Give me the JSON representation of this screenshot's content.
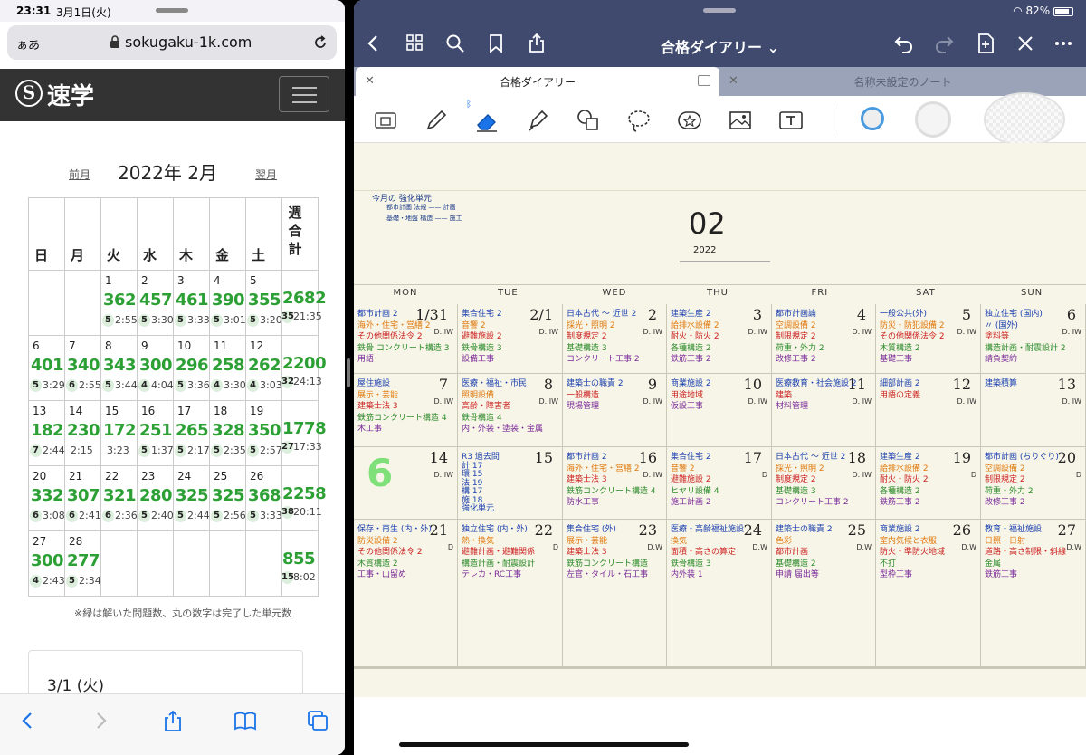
{
  "left_status": {
    "time": "23:31",
    "date": "3月1日(火)"
  },
  "browser": {
    "aa": "ぁあ",
    "url": "sokugaku-1k.com"
  },
  "site": {
    "logo_mark": "S",
    "logo_text": "速学"
  },
  "calendar": {
    "title": "2022年 2月",
    "prev": "前月",
    "next": "翌月",
    "headers": [
      "日",
      "月",
      "火",
      "水",
      "木",
      "金",
      "土"
    ],
    "total_header": [
      "週",
      "合",
      "計"
    ],
    "weeks": [
      {
        "days": [
          null,
          null,
          {
            "d": "1",
            "c": "362",
            "u": "5",
            "t": "2:55"
          },
          {
            "d": "2",
            "c": "457",
            "u": "5",
            "t": "3:30"
          },
          {
            "d": "3",
            "c": "461",
            "u": "5",
            "t": "3:33"
          },
          {
            "d": "4",
            "c": "390",
            "u": "5",
            "t": "3:01"
          },
          {
            "d": "5",
            "c": "355",
            "u": "5",
            "t": "3:20"
          }
        ],
        "total": {
          "c": "2682",
          "u": "35",
          "t": "21:35"
        }
      },
      {
        "days": [
          {
            "d": "6",
            "c": "401",
            "u": "5",
            "t": "3:29"
          },
          {
            "d": "7",
            "c": "340",
            "u": "6",
            "t": "2:55"
          },
          {
            "d": "8",
            "c": "343",
            "u": "5",
            "t": "3:44"
          },
          {
            "d": "9",
            "c": "300",
            "u": "4",
            "t": "4:04"
          },
          {
            "d": "10",
            "c": "296",
            "u": "5",
            "t": "3:36"
          },
          {
            "d": "11",
            "c": "258",
            "u": "4",
            "t": "3:30"
          },
          {
            "d": "12",
            "c": "262",
            "u": "4",
            "t": "3:03"
          }
        ],
        "total": {
          "c": "2200",
          "u": "32",
          "t": "24:13"
        }
      },
      {
        "days": [
          {
            "d": "13",
            "c": "182",
            "u": "7",
            "t": "2:44"
          },
          {
            "d": "14",
            "c": "230",
            "u": "",
            "t": "2:15"
          },
          {
            "d": "15",
            "c": "172",
            "u": "",
            "t": "3:23"
          },
          {
            "d": "16",
            "c": "251",
            "u": "5",
            "t": "1:37"
          },
          {
            "d": "17",
            "c": "265",
            "u": "5",
            "t": "2:17"
          },
          {
            "d": "18",
            "c": "328",
            "u": "5",
            "t": "2:35"
          },
          {
            "d": "19",
            "c": "350",
            "u": "5",
            "t": "2:57"
          }
        ],
        "total": {
          "c": "1778",
          "u": "27",
          "t": "17:33"
        }
      },
      {
        "days": [
          {
            "d": "20",
            "c": "332",
            "u": "6",
            "t": "3:08"
          },
          {
            "d": "21",
            "c": "307",
            "u": "6",
            "t": "2:41"
          },
          {
            "d": "22",
            "c": "321",
            "u": "6",
            "t": "2:36"
          },
          {
            "d": "23",
            "c": "280",
            "u": "5",
            "t": "2:40"
          },
          {
            "d": "24",
            "c": "325",
            "u": "5",
            "t": "2:44"
          },
          {
            "d": "25",
            "c": "325",
            "u": "5",
            "t": "2:56"
          },
          {
            "d": "26",
            "c": "368",
            "u": "5",
            "t": "3:33"
          }
        ],
        "total": {
          "c": "2258",
          "u": "38",
          "t": "20:11"
        }
      },
      {
        "days": [
          {
            "d": "27",
            "c": "300",
            "u": "4",
            "t": "2:43"
          },
          {
            "d": "28",
            "c": "277",
            "u": "5",
            "t": "2:34"
          },
          null,
          null,
          null,
          null,
          null
        ],
        "total": {
          "c": "855",
          "u": "15",
          "t": "8:02"
        }
      }
    ],
    "note": "※緑は解いた問題数、丸の数字は完了した単元数",
    "detail_date": "3/1 (火)"
  },
  "right_status": {
    "battery": "82%"
  },
  "goodnotes": {
    "title": "合格ダイアリー ⌄",
    "tab_active": "合格ダイアリー",
    "tab_inactive": "名称未設定のノート",
    "page": {
      "header_note": [
        "今月の 強化単元",
        "都市計画  法規 —— 計画",
        "基礎・地盤  構造 —— 施工"
      ],
      "month": "02",
      "year": "2022",
      "dow": [
        "MON",
        "TUE",
        "WED",
        "THU",
        "FRI",
        "SAT",
        "SUN"
      ],
      "big_digit": "6",
      "weeks": [
        [
          {
            "dn": "1/31",
            "lines": [
              [
                "都市計画 2",
                "#1a3fb0"
              ],
              [
                "海外・住宅・営繕 2",
                "#e07a10"
              ],
              [
                "その他関係法令 2",
                "#cc2222"
              ],
              [
                "鉄骨 コンクリート構造 3",
                "#2a8a2a"
              ],
              [
                "用語",
                "#7a2a9a"
              ]
            ],
            "dw": "D. IW"
          },
          {
            "dn": "2/1",
            "lines": [
              [
                "集合住宅 2",
                "#1a3fb0"
              ],
              [
                "音響 2",
                "#e07a10"
              ],
              [
                "避難施設 2",
                "#cc2222"
              ],
              [
                "鉄骨構造 3",
                "#2a8a2a"
              ],
              [
                "設備工事",
                "#7a2a9a"
              ]
            ],
            "dw": "D. IW"
          },
          {
            "dn": "2",
            "lines": [
              [
                "日本古代 〜 近世 2",
                "#1a3fb0"
              ],
              [
                "採光・照明 2",
                "#e07a10"
              ],
              [
                "制度規定 2",
                "#cc2222"
              ],
              [
                "基礎構造 3",
                "#2a8a2a"
              ],
              [
                "コンクリート工事 2",
                "#7a2a9a"
              ]
            ],
            "dw": "D. IW"
          },
          {
            "dn": "3",
            "lines": [
              [
                "建築生産 2",
                "#1a3fb0"
              ],
              [
                "給排水設備 2",
                "#e07a10"
              ],
              [
                "耐火・防火 2",
                "#cc2222"
              ],
              [
                "各種構造 2",
                "#2a8a2a"
              ],
              [
                "鉄筋工事 2",
                "#7a2a9a"
              ]
            ],
            "dw": "D. IW"
          },
          {
            "dn": "4",
            "lines": [
              [
                "都市計画論",
                "#1a3fb0"
              ],
              [
                "空調設備 2",
                "#e07a10"
              ],
              [
                "制限規定 2",
                "#cc2222"
              ],
              [
                "荷重・外力 2",
                "#2a8a2a"
              ],
              [
                "改修工事 2",
                "#7a2a9a"
              ]
            ],
            "dw": "D. IW"
          },
          {
            "dn": "5",
            "lines": [
              [
                "一般公共(外)",
                "#1a3fb0"
              ],
              [
                "防災・防犯設備 2",
                "#e07a10"
              ],
              [
                "その他関係法令 2",
                "#cc2222"
              ],
              [
                "木質構造 2",
                "#2a8a2a"
              ],
              [
                "基礎工事",
                "#7a2a9a"
              ]
            ],
            "dw": "D. IW"
          },
          {
            "dn": "6",
            "lines": [
              [
                "独立住宅 (国内)",
                "#1a3fb0"
              ],
              [
                "〃 (国外)",
                "#1a3fb0"
              ],
              [
                "塗料等",
                "#cc2222"
              ],
              [
                "構造計画・耐震設計 2",
                "#2a8a2a"
              ],
              [
                "請負契約",
                "#7a2a9a"
              ]
            ],
            "dw": "D. IW"
          }
        ],
        [
          {
            "dn": "7",
            "lines": [
              [
                "屋住施設",
                "#1a3fb0"
              ],
              [
                "展示・芸能",
                "#e07a10"
              ],
              [
                "建築士法 3",
                "#cc2222"
              ],
              [
                "鉄筋コンクリート構造 4",
                "#2a8a2a"
              ],
              [
                "木工事",
                "#7a2a9a"
              ]
            ],
            "dw": "D. IW"
          },
          {
            "dn": "8",
            "lines": [
              [
                "医療・福祉・市民",
                "#1a3fb0"
              ],
              [
                "照明設備",
                "#e07a10"
              ],
              [
                "高齢・障害者",
                "#cc2222"
              ],
              [
                "鉄骨構造 4",
                "#2a8a2a"
              ],
              [
                "内・外装・塗装・金属",
                "#7a2a9a"
              ]
            ],
            "dw": "D. IW"
          },
          {
            "dn": "9",
            "lines": [
              [
                "建築士の職責 2",
                "#1a3fb0"
              ],
              [
                "一般構造",
                "#cc2222"
              ],
              [
                "現場管理",
                "#7a2a9a"
              ]
            ],
            "dw": "D. IW"
          },
          {
            "dn": "10",
            "lines": [
              [
                "商業施設 2",
                "#1a3fb0"
              ],
              [
                "用途地域",
                "#cc2222"
              ],
              [
                "仮設工事",
                "#7a2a9a"
              ]
            ],
            "dw": "D. IW"
          },
          {
            "dn": "11",
            "lines": [
              [
                "医療教育・社会施設 2",
                "#1a3fb0"
              ],
              [
                "建築",
                "#cc2222"
              ],
              [
                "材料管理",
                "#7a2a9a"
              ]
            ],
            "dw": "D. IW"
          },
          {
            "dn": "12",
            "lines": [
              [
                "細部計画 2",
                "#1a3fb0"
              ],
              [
                "用語の定義",
                "#cc2222"
              ]
            ],
            "dw": "D. IW"
          },
          {
            "dn": "13",
            "lines": [
              [
                "建築積算",
                "#1a3fb0"
              ]
            ],
            "dw": "D. IW"
          }
        ],
        [
          {
            "dn": "14",
            "lines": [],
            "dw": "D. IW"
          },
          {
            "dn": "15",
            "lines": [
              [
                "R3 過去問",
                "#1a3fb0"
              ],
              [
                "計 17",
                "#1a3fb0"
              ],
              [
                "環 15",
                "#1a3fb0"
              ],
              [
                "法 19",
                "#1a3fb0"
              ],
              [
                "構 17",
                "#1a3fb0"
              ],
              [
                "施 18",
                "#1a3fb0"
              ],
              [
                "強化単元",
                "#1a3fb0"
              ]
            ],
            "dw": ""
          },
          {
            "dn": "16",
            "lines": [
              [
                "都市計画 2",
                "#1a3fb0"
              ],
              [
                "海外・住宅・営繕 2",
                "#e07a10"
              ],
              [
                "建築士法 3",
                "#cc2222"
              ],
              [
                "鉄筋コンクリート構造 4",
                "#2a8a2a"
              ],
              [
                "防水工事",
                "#7a2a9a"
              ]
            ],
            "dw": "D. IW"
          },
          {
            "dn": "17",
            "lines": [
              [
                "集合住宅 2",
                "#1a3fb0"
              ],
              [
                "音響 2",
                "#e07a10"
              ],
              [
                "避難施設 2",
                "#cc2222"
              ],
              [
                "ヒヤリ設備 4",
                "#2a8a2a"
              ],
              [
                "施工計画 2",
                "#7a2a9a"
              ]
            ],
            "dw": "D"
          },
          {
            "dn": "18",
            "lines": [
              [
                "日本古代 〜 近世 2",
                "#1a3fb0"
              ],
              [
                "採光・照明 2",
                "#e07a10"
              ],
              [
                "制度規定 2",
                "#cc2222"
              ],
              [
                "基礎構造 3",
                "#2a8a2a"
              ],
              [
                "コンクリート工事 2",
                "#7a2a9a"
              ]
            ],
            "dw": "D. IW"
          },
          {
            "dn": "19",
            "lines": [
              [
                "建築生産 2",
                "#1a3fb0"
              ],
              [
                "給排水設備 2",
                "#e07a10"
              ],
              [
                "耐火・防火 2",
                "#cc2222"
              ],
              [
                "各種構造 2",
                "#2a8a2a"
              ],
              [
                "鉄筋工事 2",
                "#7a2a9a"
              ]
            ],
            "dw": "D"
          },
          {
            "dn": "20",
            "lines": [
              [
                "都市計画 (ちりぐり)",
                "#1a3fb0"
              ],
              [
                "空調設備 2",
                "#e07a10"
              ],
              [
                "制限規定 2",
                "#cc2222"
              ],
              [
                "荷重・外力 2",
                "#2a8a2a"
              ],
              [
                "改修工事 2",
                "#7a2a9a"
              ]
            ],
            "dw": "D"
          }
        ],
        [
          {
            "dn": "21",
            "lines": [
              [
                "保存・再生 (内・外)",
                "#1a3fb0"
              ],
              [
                "防災設備 2",
                "#e07a10"
              ],
              [
                "その他関係法令 2",
                "#cc2222"
              ],
              [
                "木質構造 2",
                "#2a8a2a"
              ],
              [
                "工事・山留め",
                "#7a2a9a"
              ]
            ],
            "dw": "D"
          },
          {
            "dn": "22",
            "lines": [
              [
                "独立住宅 (内・外)",
                "#1a3fb0"
              ],
              [
                "熱・換気",
                "#e07a10"
              ],
              [
                "避難計画・避難関係",
                "#cc2222"
              ],
              [
                "構造計画・耐震設計",
                "#2a8a2a"
              ],
              [
                "テレカ・RC工事",
                "#7a2a9a"
              ]
            ],
            "dw": "D"
          },
          {
            "dn": "23",
            "lines": [
              [
                "集合住宅 (外)",
                "#1a3fb0"
              ],
              [
                "展示・芸能",
                "#e07a10"
              ],
              [
                "建築士法 3",
                "#cc2222"
              ],
              [
                "鉄筋コンクリート構造",
                "#2a8a2a"
              ],
              [
                "左官・タイル・石工事",
                "#7a2a9a"
              ]
            ],
            "dw": "D.W"
          },
          {
            "dn": "24",
            "lines": [
              [
                "医療・高齢福祉施設",
                "#1a3fb0"
              ],
              [
                "換気",
                "#e07a10"
              ],
              [
                "面積・高さの算定",
                "#cc2222"
              ],
              [
                "鉄骨構造 3",
                "#2a8a2a"
              ],
              [
                "内外装 1",
                "#7a2a9a"
              ]
            ],
            "dw": "D.W"
          },
          {
            "dn": "25",
            "lines": [
              [
                "建築士の職責 2",
                "#1a3fb0"
              ],
              [
                "色彩",
                "#e07a10"
              ],
              [
                "都市計画",
                "#cc2222"
              ],
              [
                "基礎構造 2",
                "#2a8a2a"
              ],
              [
                "申請 届出等",
                "#7a2a9a"
              ]
            ],
            "dw": "D.W"
          },
          {
            "dn": "26",
            "lines": [
              [
                "商業施設 2",
                "#1a3fb0"
              ],
              [
                "室内気候と衣服",
                "#e07a10"
              ],
              [
                "防火・準防火地域",
                "#cc2222"
              ],
              [
                "不打",
                "#2a8a2a"
              ],
              [
                "型枠工事",
                "#7a2a9a"
              ]
            ],
            "dw": "D.W"
          },
          {
            "dn": "27",
            "lines": [
              [
                "教育・福祉施設",
                "#1a3fb0"
              ],
              [
                "日照・日射",
                "#e07a10"
              ],
              [
                "道路・高さ制限・斜線",
                "#cc2222"
              ],
              [
                "金属",
                "#2a8a2a"
              ],
              [
                "鉄筋工事",
                "#7a2a9a"
              ]
            ],
            "dw": "D.W"
          }
        ]
      ]
    }
  }
}
